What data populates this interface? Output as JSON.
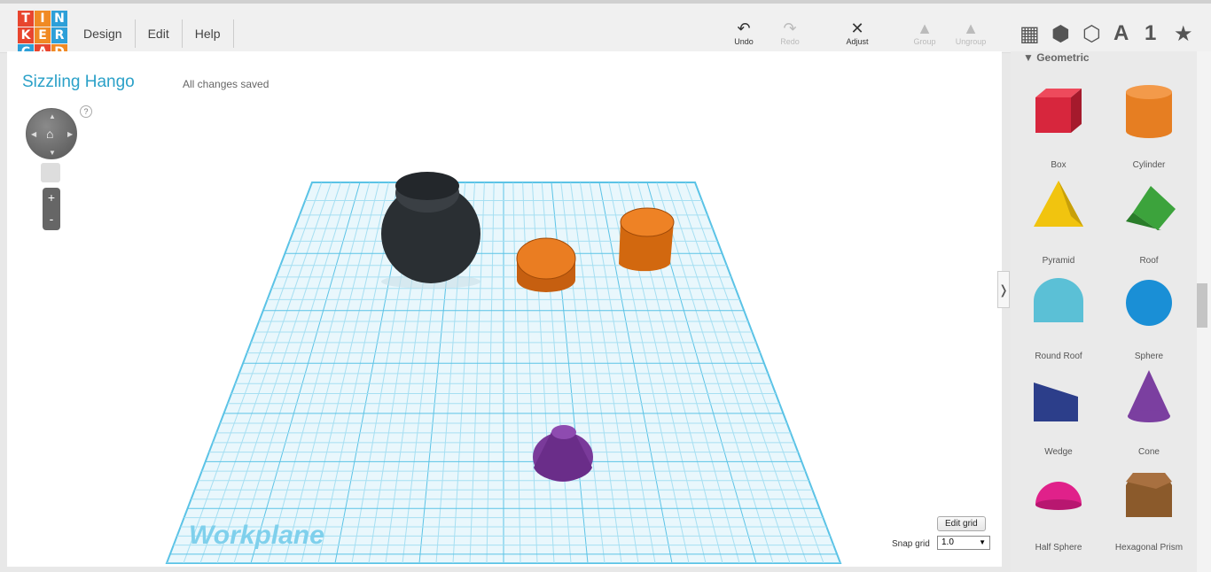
{
  "logo": {
    "letters": [
      "T",
      "I",
      "N",
      "K",
      "E",
      "R",
      "C",
      "A",
      "D"
    ],
    "colors": [
      "#e8452e",
      "#f08a24",
      "#2d9fd8",
      "#e8452e",
      "#f08a24",
      "#2d9fd8",
      "#2d9fd8",
      "#e8452e",
      "#f08a24"
    ]
  },
  "menu": [
    "Design",
    "Edit",
    "Help"
  ],
  "toolbar": {
    "undo": "Undo",
    "redo": "Redo",
    "adjust": "Adjust",
    "group": "Group",
    "ungroup": "Ungroup",
    "text_icon": "A",
    "number_icon": "1"
  },
  "project": {
    "title": "Sizzling Hango",
    "status": "All changes saved"
  },
  "nav": {
    "help": "?",
    "zoom_in": "+",
    "zoom_out": "-"
  },
  "workplane": {
    "label": "Workplane",
    "edit_grid": "Edit grid",
    "snap_label": "Snap grid",
    "snap_value": "1.0"
  },
  "panel": {
    "section": "Geometric",
    "shapes": [
      {
        "label": "Box",
        "color": "#d7263d"
      },
      {
        "label": "Cylinder",
        "color": "#e67e22"
      },
      {
        "label": "Pyramid",
        "color": "#f1c40f"
      },
      {
        "label": "Roof",
        "color": "#3ca33c"
      },
      {
        "label": "Round Roof",
        "color": "#5bc0d6"
      },
      {
        "label": "Sphere",
        "color": "#1a8fd6"
      },
      {
        "label": "Wedge",
        "color": "#2c3e8a"
      },
      {
        "label": "Cone",
        "color": "#7b3fa0"
      },
      {
        "label": "Half Sphere",
        "color": "#e0218a"
      },
      {
        "label": "Hexagonal Prism",
        "color": "#8b5a2b"
      }
    ]
  },
  "colors": {
    "accent": "#2ba1c8",
    "grid": "#5bc3e6"
  }
}
